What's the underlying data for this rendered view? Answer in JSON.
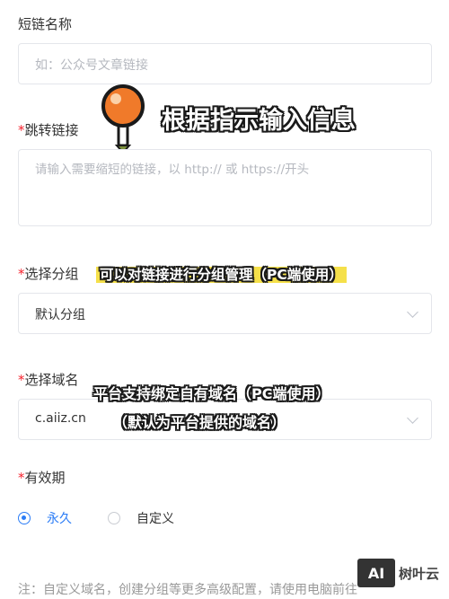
{
  "form": {
    "name_label": "短链名称",
    "name_placeholder": "如：公众号文章链接",
    "url_label": "跳转链接",
    "url_placeholder": "请输入需要缩短的链接，以 http:// 或 https://开头",
    "group_label": "选择分组",
    "group_value": "默认分组",
    "domain_label": "选择域名",
    "domain_value": "c.aiiz.cn",
    "validity_label": "有效期",
    "validity_options": [
      "永久",
      "自定义"
    ],
    "required_mark": "*",
    "note": "注：自定义域名，创建分组等更多高级配置，请使用电脑前往"
  },
  "annotations": {
    "input_hint": "根据指示输入信息",
    "group_hint": "可以对链接进行分组管理（PC端使用）",
    "domain_hint_line1": "平台支持绑定自有域名（PC端使用）",
    "domain_hint_line2": "（默认为平台提供的域名）"
  },
  "watermark": {
    "logo": "AI",
    "text": "树叶云"
  },
  "colors": {
    "accent": "#2b7cf6",
    "required": "#f5222d",
    "highlight": "#f5e04a",
    "pin": "#f07a2a"
  },
  "icons": [
    "pushpin-icon",
    "chevron-down-icon",
    "radio-icon"
  ]
}
